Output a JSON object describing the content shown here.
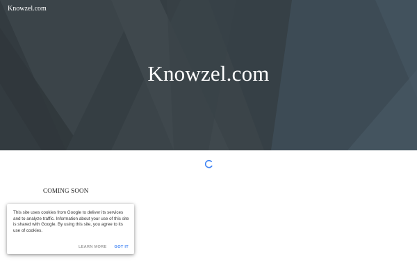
{
  "header": {
    "site_name": "Knowzel.com"
  },
  "hero": {
    "title": "Knowzel.com"
  },
  "main": {
    "coming_soon": "COMING SOON"
  },
  "cookie_banner": {
    "message": "This site uses cookies from Google to deliver its services and to analyze traffic. Information about your use of this site is shared with Google. By using this site, you agree to its use of cookies.",
    "learn_more_label": "LEARN MORE",
    "got_it_label": "GOT IT"
  },
  "colors": {
    "hero_bg": "#3a4348",
    "accent": "#4285f4"
  },
  "icons": {
    "loading": "loading-spinner-icon"
  }
}
